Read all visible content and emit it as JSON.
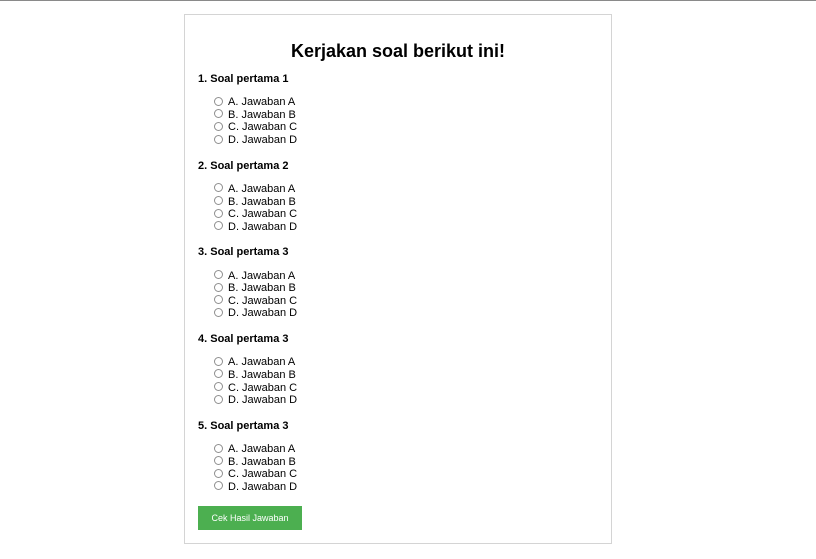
{
  "page": {
    "title": "Kerjakan soal berikut ini!"
  },
  "questions": [
    {
      "label": "1. Soal pertama 1",
      "options": [
        "A. Jawaban A",
        "B. Jawaban B",
        "C. Jawaban C",
        "D. Jawaban D"
      ]
    },
    {
      "label": "2. Soal pertama 2",
      "options": [
        "A. Jawaban A",
        "B. Jawaban B",
        "C. Jawaban C",
        "D. Jawaban D"
      ]
    },
    {
      "label": "3. Soal pertama 3",
      "options": [
        "A. Jawaban A",
        "B. Jawaban B",
        "C. Jawaban C",
        "D. Jawaban D"
      ]
    },
    {
      "label": "4. Soal pertama 3",
      "options": [
        "A. Jawaban A",
        "B. Jawaban B",
        "C. Jawaban C",
        "D. Jawaban D"
      ]
    },
    {
      "label": "5. Soal pertama 3",
      "options": [
        "A. Jawaban A",
        "B. Jawaban B",
        "C. Jawaban C",
        "D. Jawaban D"
      ]
    }
  ],
  "submit_label": "Cek Hasil Jawaban",
  "colors": {
    "button": "#4caf50",
    "button_text": "#ffffff",
    "card_border": "#d4d4d4"
  }
}
